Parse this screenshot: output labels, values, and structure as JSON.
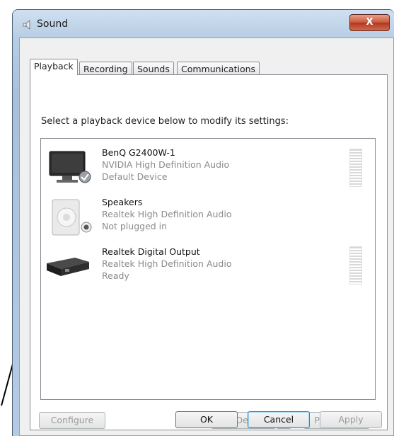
{
  "window": {
    "title": "Sound",
    "close_label": "X"
  },
  "tabs": [
    {
      "label": "Playback",
      "active": true
    },
    {
      "label": "Recording",
      "active": false
    },
    {
      "label": "Sounds",
      "active": false
    },
    {
      "label": "Communications",
      "active": false
    }
  ],
  "instructions": "Select a playback device below to modify its settings:",
  "devices": [
    {
      "name": "BenQ G2400W-1",
      "driver": "NVIDIA High Definition Audio",
      "status": "Default Device",
      "icon": "monitor-icon",
      "badge": "default-check-icon"
    },
    {
      "name": "Speakers",
      "driver": "Realtek High Definition Audio",
      "status": "Not plugged in",
      "icon": "speaker-icon",
      "badge": "unplugged-icon"
    },
    {
      "name": "Realtek Digital Output",
      "driver": "Realtek High Definition Audio",
      "status": "Ready",
      "icon": "digital-output-icon"
    }
  ],
  "buttons": {
    "configure": "Configure",
    "set_default": "Set Default",
    "properties": "Properties",
    "ok": "OK",
    "cancel": "Cancel",
    "apply": "Apply"
  },
  "colors": {
    "accent": "#3399ff",
    "close": "#c8563a",
    "disabled_text": "#9a9a9a"
  }
}
